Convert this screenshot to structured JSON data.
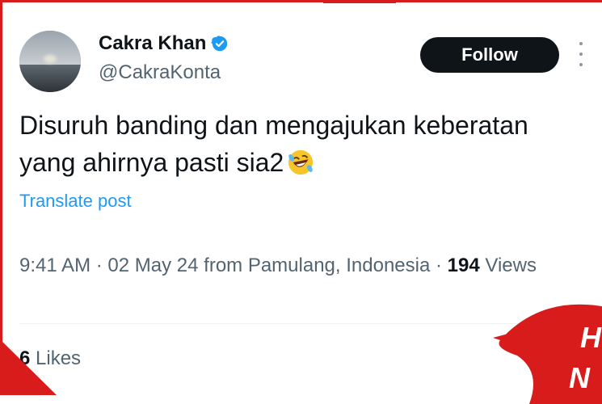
{
  "tweet": {
    "author": {
      "display_name": "Cakra Khan",
      "handle": "@CakraKonta",
      "verified": true,
      "avatar": "avatar-image"
    },
    "follow_label": "Follow",
    "more_icon": "more-icon",
    "text_line1": "Disuruh banding dan mengajukan keberatan",
    "text_line2": "yang ahirnya pasti sia2",
    "emoji": "rolling-on-floor-laughing",
    "translate_label": "Translate post",
    "meta": {
      "time": "9:41 AM",
      "date": "02 May 24",
      "from_label": "from",
      "location": "Pamulang, Indonesia",
      "views_count": "194",
      "views_label": "Views"
    },
    "likes_count": "6",
    "likes_label": "Likes"
  },
  "colors": {
    "frame_red": "#d81b1b",
    "verified_blue": "#1d9bf0",
    "link_blue": "#1d9bf0",
    "secondary_text": "#536471",
    "primary_text": "#0f1419"
  }
}
